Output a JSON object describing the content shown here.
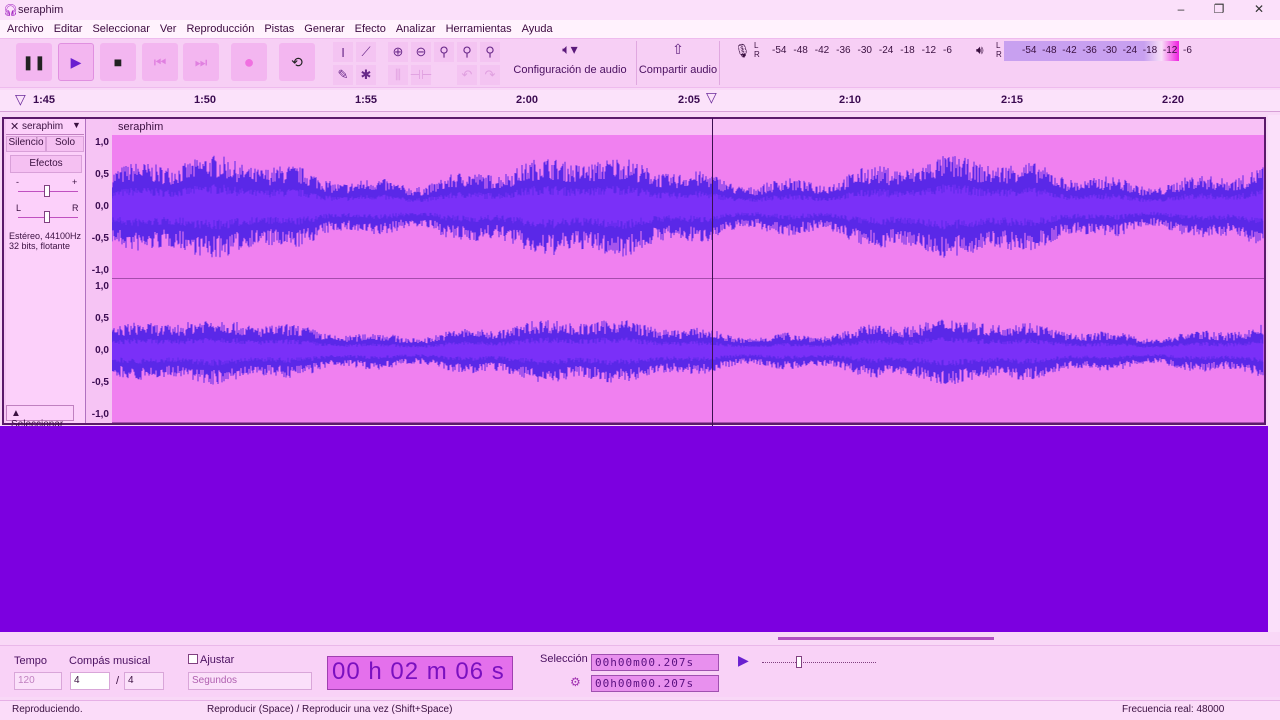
{
  "window": {
    "title": "seraphim",
    "minimize": "–",
    "maximize": "❐",
    "close": "✕"
  },
  "menu": [
    "Archivo",
    "Editar",
    "Seleccionar",
    "Ver",
    "Reproducción",
    "Pistas",
    "Generar",
    "Efecto",
    "Analizar",
    "Herramientas",
    "Ayuda"
  ],
  "toolbar": {
    "audio_setup": "Configuración de audio",
    "share_audio": "Compartir audio",
    "meter_scale": [
      "-54",
      "-48",
      "-42",
      "-36",
      "-30",
      "-24",
      "-18",
      "-12",
      "-6"
    ],
    "playback_level": 0.92
  },
  "ruler": {
    "ticks": [
      "1:45",
      "1:50",
      "1:55",
      "2:00",
      "2:05",
      "2:10",
      "2:15",
      "2:20"
    ]
  },
  "track": {
    "name": "seraphim",
    "clip_name": "seraphim",
    "mute": "Silencio",
    "solo": "Solo",
    "effects": "Efectos",
    "gain_minus": "-",
    "gain_plus": "+",
    "pan_l": "L",
    "pan_r": "R",
    "info1": "Estéreo, 44100Hz",
    "info2": "32 bits, flotante",
    "select": "Seleccionar",
    "vruler": [
      "1,0",
      "0,5",
      "0,0",
      "-0,5",
      "-1,0"
    ]
  },
  "bottom": {
    "tempo_label": "Tempo",
    "tempo": "120",
    "meter_label": "Compás musical",
    "meter_num": "4",
    "meter_sep": "/",
    "meter_den": "4",
    "snap_label": "Ajustar",
    "snap_unit": "Segundos",
    "time": {
      "h": "00",
      "m": "02",
      "s": "06"
    },
    "selection_label": "Selección",
    "sel_start": "00h00m00.207s",
    "sel_end": "00h00m00.207s"
  },
  "status": {
    "state": "Reproduciendo.",
    "hint": "Reproducir (Space) / Reproducir una vez (Shift+Space)",
    "rate": "Frecuencia real: 48000"
  },
  "colors": {
    "wave": "#5a28e8",
    "wave_bg": "#f080f0",
    "empty": "#7c00e0"
  }
}
